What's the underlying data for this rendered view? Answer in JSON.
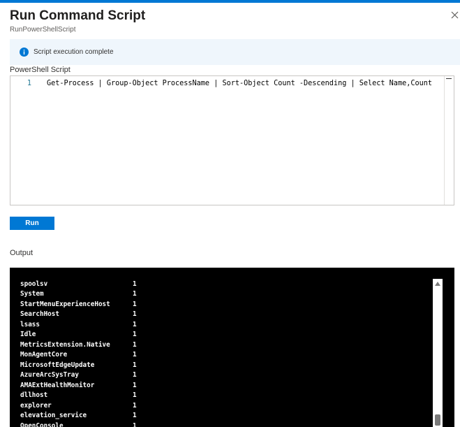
{
  "header": {
    "title": "Run Command Script",
    "subtitle": "RunPowerShellScript"
  },
  "info": {
    "icon": "info-icon",
    "message": "Script execution complete",
    "color": "#0078d4"
  },
  "script": {
    "label": "PowerShell Script",
    "lines": [
      {
        "number": "1",
        "code": "Get-Process | Group-Object ProcessName | Sort-Object Count -Descending | Select Name,Count"
      }
    ]
  },
  "run_button": {
    "label": "Run"
  },
  "output": {
    "label": "Output",
    "rows": [
      {
        "name": "spoolsv",
        "count": "1"
      },
      {
        "name": "System",
        "count": "1"
      },
      {
        "name": "StartMenuExperienceHost",
        "count": "1"
      },
      {
        "name": "SearchHost",
        "count": "1"
      },
      {
        "name": "lsass",
        "count": "1"
      },
      {
        "name": "Idle",
        "count": "1"
      },
      {
        "name": "MetricsExtension.Native",
        "count": "1"
      },
      {
        "name": "MonAgentCore",
        "count": "1"
      },
      {
        "name": "MicrosoftEdgeUpdate",
        "count": "1"
      },
      {
        "name": "AzureArcSysTray",
        "count": "1"
      },
      {
        "name": "AMAExtHealthMonitor",
        "count": "1"
      },
      {
        "name": "dllhost",
        "count": "1"
      },
      {
        "name": "explorer",
        "count": "1"
      },
      {
        "name": "elevation_service",
        "count": "1"
      },
      {
        "name": "OpenConsole",
        "count": "1"
      }
    ]
  },
  "colors": {
    "accent": "#0078d4",
    "console_bg": "#000000",
    "info_bg": "#eff6fc"
  }
}
